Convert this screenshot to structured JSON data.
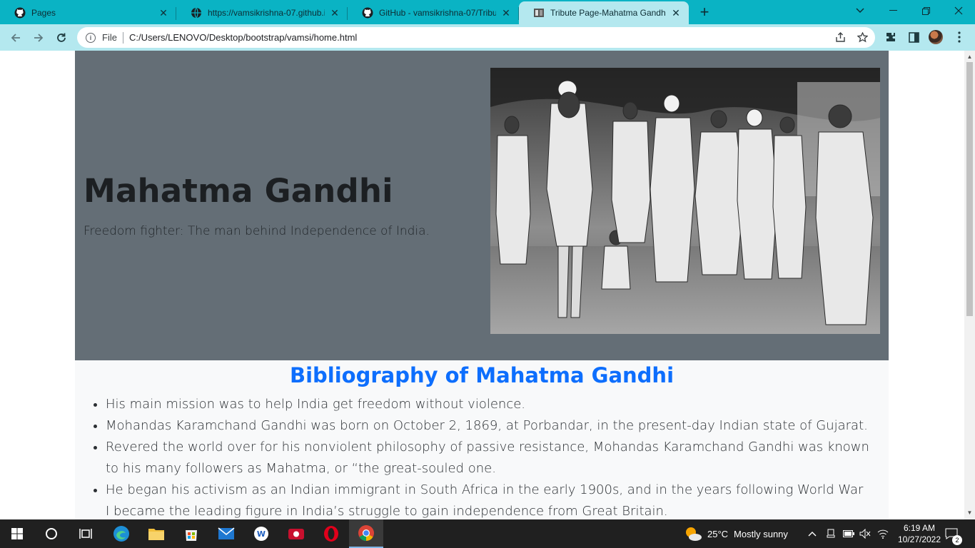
{
  "tabs": [
    {
      "title": "Pages",
      "icon": "github-icon"
    },
    {
      "title": "https://vamsikrishna-07.github.io/",
      "icon": "globe-icon"
    },
    {
      "title": "GitHub - vamsikrishna-07/Tribute",
      "icon": "github-icon"
    },
    {
      "title": "Tribute Page-Mahatma Gandhi",
      "icon": "page-favicon",
      "active": true
    }
  ],
  "toolbar": {
    "scheme": "File",
    "url": "C:/Users/LENOVO/Desktop/bootstrap/vamsi/home.html"
  },
  "hero": {
    "title": "Mahatma Gandhi",
    "subtitle": "Freedom fighter: The man behind Independence of India."
  },
  "bibliography": {
    "title": "Bibliography of Mahatma Gandhi",
    "items": [
      "His main mission was to help India get freedom without violence.",
      "Mohandas Karamchand Gandhi was born on October 2, 1869, at Porbandar, in the present-day Indian state of Gujarat.",
      "Revered the world over for his nonviolent philosophy of passive resistance, Mohandas Karamchand Gandhi was known to his many followers as Mahatma, or “the great-souled one.",
      "He began his activism as an Indian immigrant in South Africa in the early 1900s, and in the years following World War I became the leading figure in India’s struggle to gain independence from Great Britain."
    ]
  },
  "taskbar": {
    "weather_temp": "25°C",
    "weather_text": "Mostly sunny",
    "time": "6:19 AM",
    "date": "10/27/2022",
    "notifications": "2"
  },
  "colors": {
    "tabstrip": "#0ab3c4",
    "toolbar": "#b4e8ef",
    "hero_bg": "#646e76",
    "bio_title": "#0d6efd",
    "taskbar": "#202020"
  }
}
